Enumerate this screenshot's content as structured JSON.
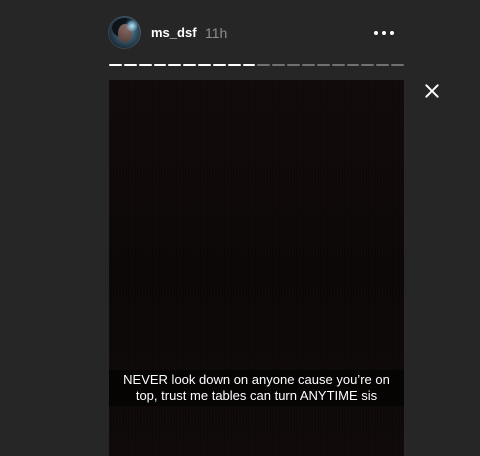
{
  "header": {
    "username": "ms_dsf",
    "time": "11h"
  },
  "progress": {
    "total_segments": 20,
    "completed_segments": 10
  },
  "story": {
    "caption_line1": "NEVER look down on anyone cause you’re on",
    "caption_line2": "top, trust me tables can turn ANYTIME sis"
  },
  "icons": {
    "avatar": "profile-avatar",
    "more": "more-horizontal-icon",
    "close": "close-icon"
  },
  "colors": {
    "background": "#262626",
    "text": "#ffffff",
    "muted": "#8e8e8e"
  }
}
